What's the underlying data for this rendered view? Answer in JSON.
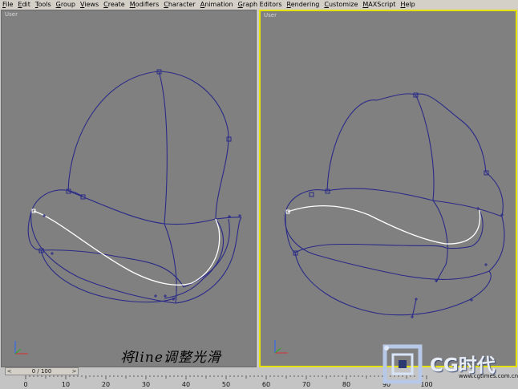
{
  "menu": [
    "File",
    "Edit",
    "Tools",
    "Group",
    "Views",
    "Create",
    "Modifiers",
    "Character",
    "Animation",
    "Graph Editors",
    "Rendering",
    "Customize",
    "MAXScript",
    "Help"
  ],
  "viewports": {
    "left": {
      "label": "User"
    },
    "right": {
      "label": "User"
    }
  },
  "caption": "将line调整光滑",
  "timeslider": {
    "frame": "0 / 100",
    "prev": "<",
    "next": ">"
  },
  "ruler": {
    "ticks": [
      "0",
      "10",
      "20",
      "30",
      "40",
      "50",
      "60",
      "70",
      "80",
      "90",
      "100"
    ]
  },
  "watermark": {
    "logo": "CG时代",
    "url": "www.cgtimes.com.cn"
  },
  "colors": {
    "spline": "#2a2a88",
    "selected_line": "#ffffff",
    "active_border": "#e6e200",
    "viewport_bg": "#808080"
  },
  "icons": [
    "axis-tripod-icon",
    "cg-logo-icon"
  ]
}
